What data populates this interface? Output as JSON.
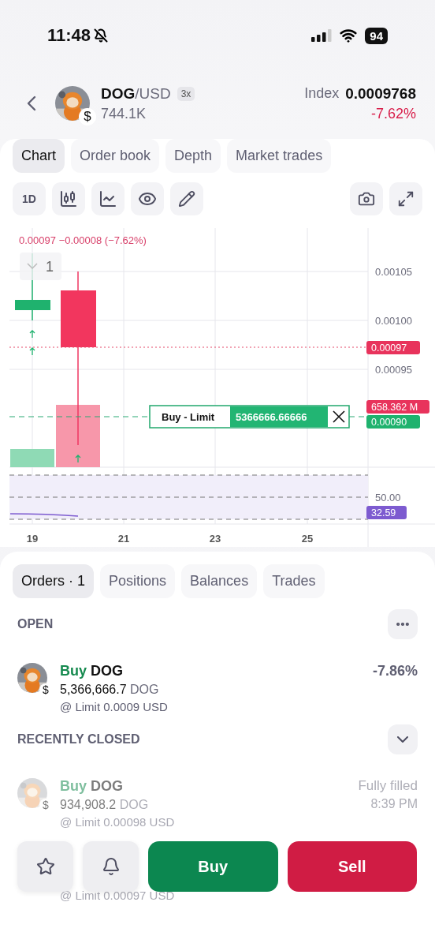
{
  "status_bar": {
    "time": "11:48",
    "battery": "94"
  },
  "header": {
    "base": "DOG",
    "quote": "/USD",
    "badge": "$",
    "leverage": "3x",
    "volume": "744.1K",
    "index_label": "Index",
    "index_value": "0.0009768",
    "change": "-7.62%"
  },
  "tabs": [
    {
      "label": "Chart",
      "selected": true
    },
    {
      "label": "Order book",
      "selected": false
    },
    {
      "label": "Depth",
      "selected": false
    },
    {
      "label": "Market trades",
      "selected": false
    }
  ],
  "toolbar": {
    "interval": "1D"
  },
  "chart": {
    "legend_price": "0.00097",
    "legend_change": "−0.00008 (−7.62%)",
    "counter": "1",
    "price_ticks": [
      "0.00105",
      "0.00100",
      "0.00095"
    ],
    "last_price_tag": "0.00097",
    "volume_tag": "658.362 M",
    "order_price_tag": "0.00090",
    "order_line": {
      "label": "Buy - Limit",
      "quantity": "5366666.66666"
    },
    "rsi_tick": "50.00",
    "rsi_tag": "32.59",
    "dates": [
      "19",
      "21",
      "23",
      "25"
    ]
  },
  "bottom_tabs": [
    {
      "label": "Orders · 1",
      "selected": true
    },
    {
      "label": "Positions",
      "selected": false
    },
    {
      "label": "Balances",
      "selected": false
    },
    {
      "label": "Trades",
      "selected": false
    }
  ],
  "open": {
    "title": "OPEN",
    "orders": [
      {
        "side": "Buy",
        "asset": "DOG",
        "badge": "$",
        "amount": "5,366,666.7",
        "unit": "DOG",
        "limit": "@ Limit 0.0009 USD",
        "result": "-7.86%",
        "faded": false
      }
    ]
  },
  "recently_closed": {
    "title": "RECENTLY CLOSED",
    "orders": [
      {
        "side": "Buy",
        "asset": "DOG",
        "badge": "$",
        "amount": "934,908.2",
        "unit": "DOG",
        "limit": "@ Limit 0.00098 USD",
        "status": "Fully filled",
        "time": "8:39 PM",
        "faded": true
      },
      {
        "limit": "@ Limit 0.00097 USD",
        "faded": true
      }
    ]
  },
  "actions": {
    "buy": "Buy",
    "sell": "Sell"
  }
}
